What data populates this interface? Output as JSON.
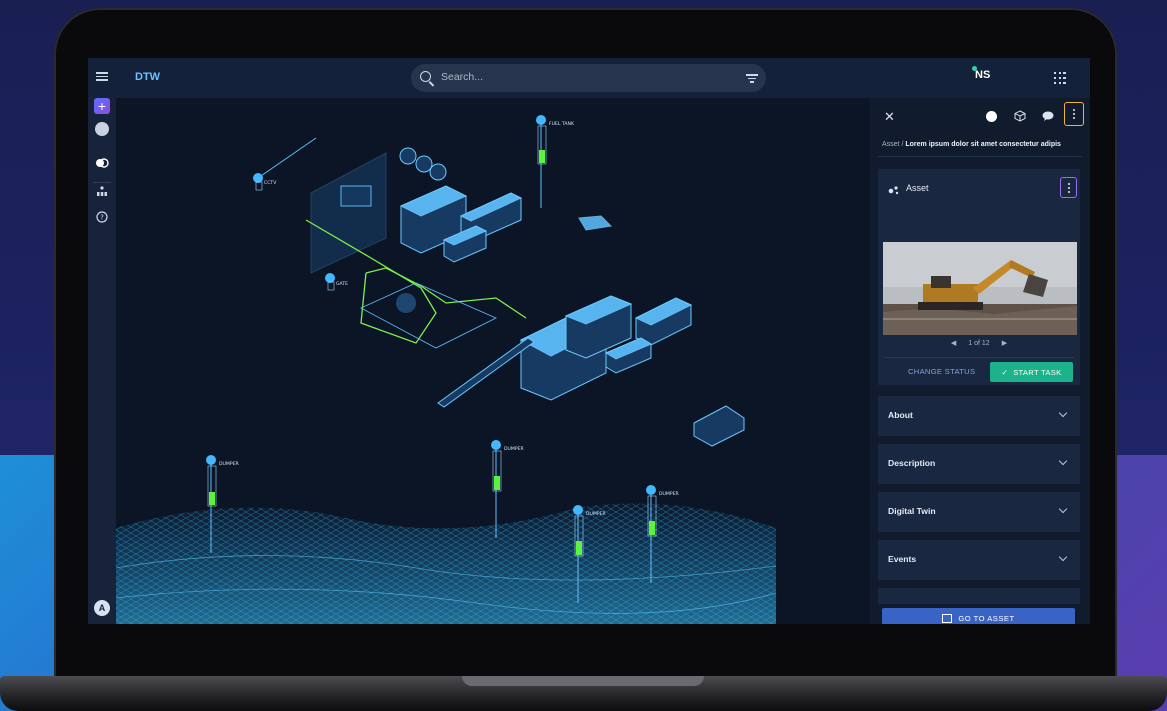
{
  "app": {
    "title": "DTW"
  },
  "search": {
    "placeholder": "Search..."
  },
  "user": {
    "initials": "NS"
  },
  "colors": {
    "accent": "#1cb28a",
    "primary": "#3a63c6",
    "highlight_outline": "#f0b43a",
    "brand_blue": "#6ec0ff"
  },
  "scene": {
    "labels": {
      "cctv": "CCTV",
      "gate": "GATE",
      "fuel_tank": "FUEL TANK",
      "dumper_1": "DUMPER",
      "dumper_2": "DUMPER",
      "dumper_3": "DUMPER",
      "dumper_4": "DUMPER"
    }
  },
  "panel": {
    "breadcrumb": {
      "root": "Asset",
      "separator": " / ",
      "current": "Lorem ipsum dolor sit amet consectetur adipis"
    },
    "asset": {
      "title": "Asset",
      "pager": "1 of 12",
      "change_status": "CHANGE STATUS",
      "start_task": "START TASK"
    },
    "sections": [
      {
        "label": "About"
      },
      {
        "label": "Description"
      },
      {
        "label": "Digital Twin"
      },
      {
        "label": "Events"
      }
    ],
    "go_to_asset": "GO TO ASSET"
  }
}
